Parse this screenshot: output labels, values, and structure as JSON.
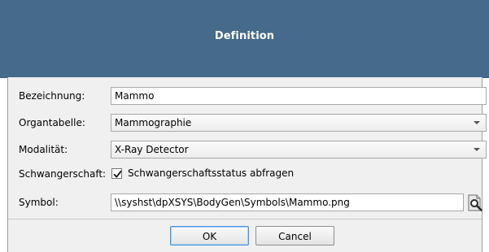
{
  "window": {
    "title": "Definition",
    "title_bar_color": "#456a8b"
  },
  "form": {
    "bezeichnung": {
      "label": "Bezeichnung:",
      "value": "Mammo"
    },
    "organtabelle": {
      "label": "Organtabelle:",
      "selected": "Mammographie"
    },
    "modalitaet": {
      "label": "Modalität:",
      "selected": "X-Ray Detector"
    },
    "schwangerschaft": {
      "label": "Schwangerschaft:",
      "checkbox_label": "Schwangerschaftsstatus abfragen",
      "checked": true
    },
    "symbol": {
      "label": "Symbol:",
      "value": "\\\\syshst\\dpXSYS\\BodyGen\\Symbols\\Mammo.png",
      "browse_icon": "search-file-icon"
    }
  },
  "buttons": {
    "ok_label": "OK",
    "cancel_label": "Cancel"
  }
}
